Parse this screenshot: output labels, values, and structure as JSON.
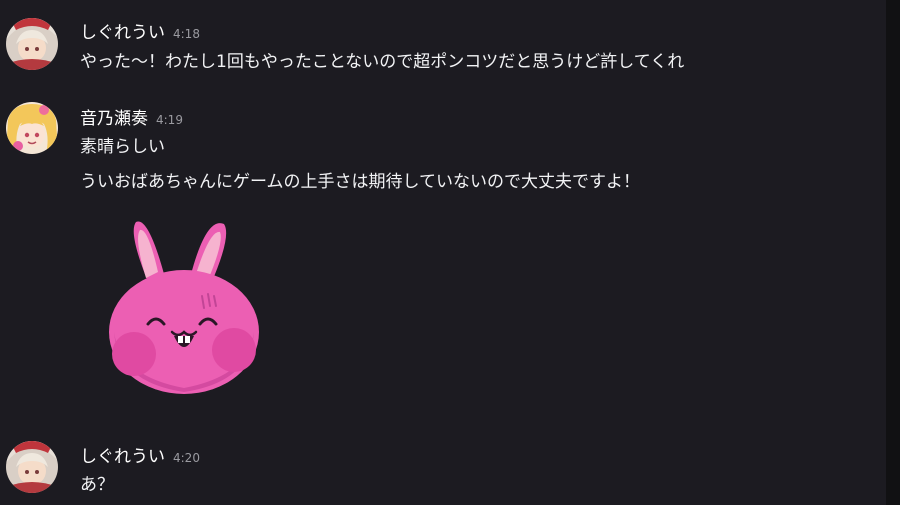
{
  "messages": [
    {
      "author": "しぐれうい",
      "time": "4:18",
      "lines": [
        "やった～！わたし1回もやったことないので超ポンコツだと思うけど許してくれ"
      ],
      "avatar_icon": "ui-avatar-icon"
    },
    {
      "author": "音乃瀬奏",
      "time": "4:19",
      "lines": [
        "素晴らしい",
        "ういおばあちゃんにゲームの上手さは期待していないので大丈夫ですよ！"
      ],
      "avatar_icon": "kanade-avatar-icon",
      "sticker": "pink-bunny-sticker"
    },
    {
      "author": "しぐれうい",
      "time": "4:20",
      "lines": [
        "あ？"
      ],
      "avatar_icon": "ui-avatar-icon"
    }
  ],
  "colors": {
    "background": "#1c1b21",
    "name": "#ffffff",
    "text": "#f2f3f5",
    "timestamp": "#9a9aa0",
    "sticker_pink": "#ec5fb3"
  }
}
